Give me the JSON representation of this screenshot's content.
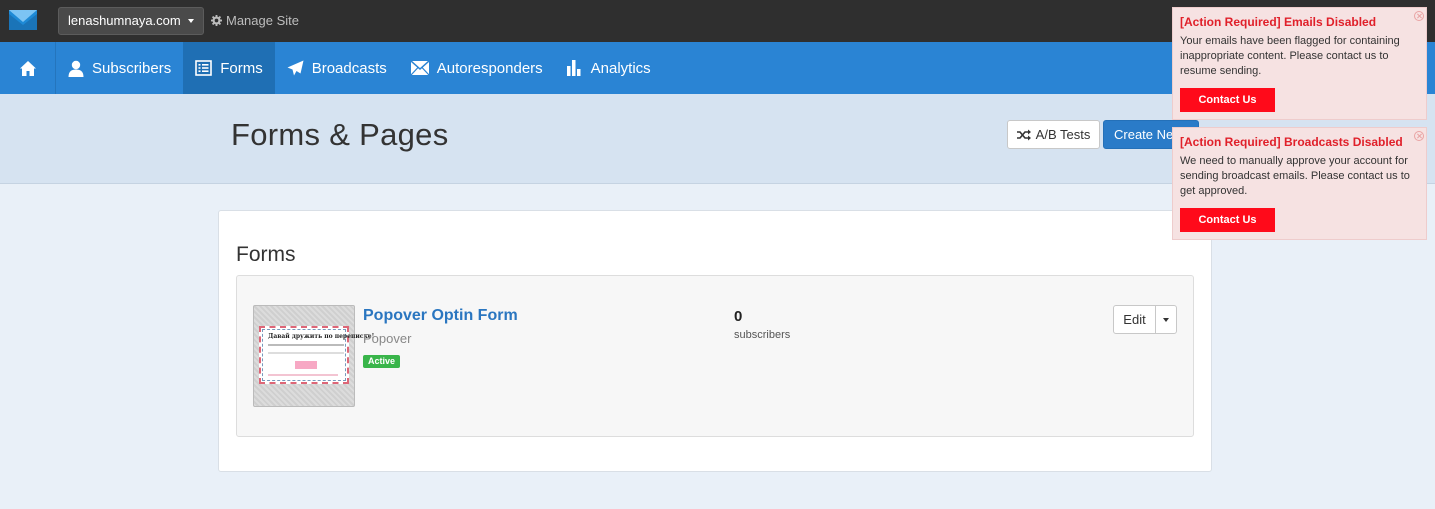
{
  "topbar": {
    "site_name": "lenashumnaya.com",
    "manage_label": "Manage Site"
  },
  "nav": {
    "items": [
      {
        "label": "Subscribers",
        "icon": "user-icon"
      },
      {
        "label": "Forms",
        "icon": "forms-icon",
        "active": true
      },
      {
        "label": "Broadcasts",
        "icon": "paper-plane-icon"
      },
      {
        "label": "Autoresponders",
        "icon": "envelope-icon"
      },
      {
        "label": "Analytics",
        "icon": "bar-chart-icon"
      }
    ]
  },
  "header": {
    "title": "Forms & Pages",
    "ab_tests_label": "A/B Tests",
    "create_new_label": "Create New"
  },
  "forms_panel": {
    "title": "Forms",
    "forms": [
      {
        "name": "Popover Optin Form",
        "type": "Popover",
        "status": "Active",
        "subscriber_count": "0",
        "subscriber_label": "subscribers",
        "edit_label": "Edit",
        "thumbnail_title": "Давай дружить по переписке!"
      }
    ]
  },
  "alerts": [
    {
      "title": "[Action Required] Emails Disabled",
      "text": "Your emails have been flagged for containing inappropriate content. Please contact us to resume sending.",
      "button": "Contact Us"
    },
    {
      "title": "[Action Required] Broadcasts Disabled",
      "text": "We need to manually approve your account for sending broadcast emails. Please contact us to get approved.",
      "button": "Contact Us"
    }
  ],
  "colors": {
    "nav_bg": "#2a84d4",
    "nav_active": "#1f6fb4",
    "topbar_bg": "#2f2f2f",
    "alert_red": "#ff0a1a",
    "badge_green": "#39b54a"
  }
}
